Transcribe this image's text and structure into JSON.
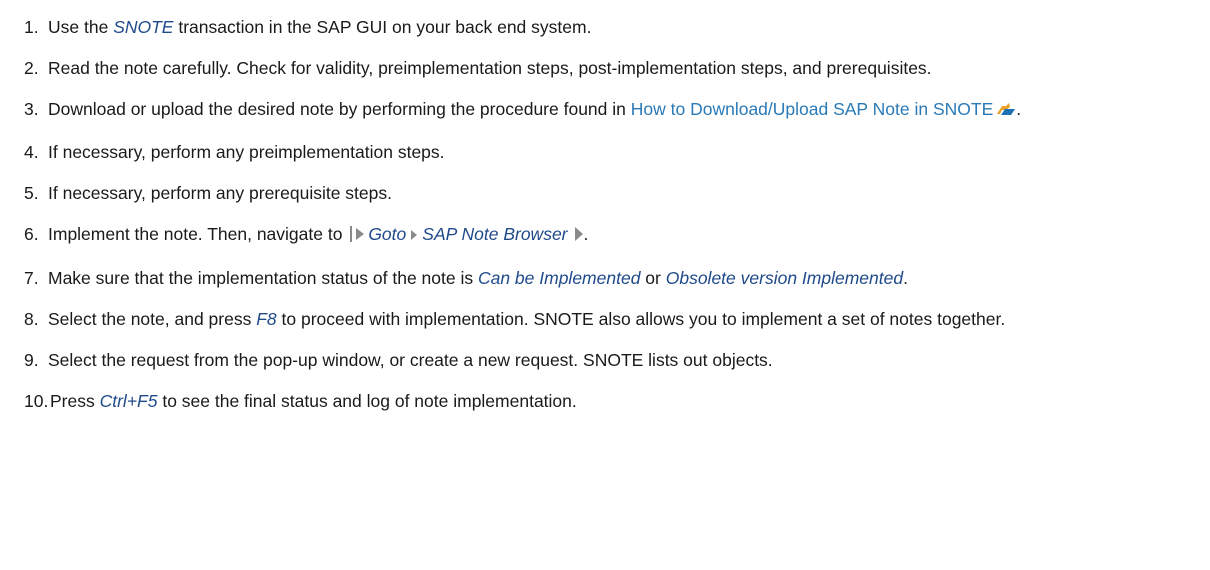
{
  "steps": [
    {
      "num": "1.",
      "parts": [
        {
          "t": "Use the "
        },
        {
          "t": "SNOTE",
          "k": "ui"
        },
        {
          "t": " transaction in the SAP GUI on your back end system."
        }
      ]
    },
    {
      "num": "2.",
      "parts": [
        {
          "t": "Read the note carefully. Check for validity, preimplementation steps, post-implementation steps, and prerequisites."
        }
      ]
    },
    {
      "num": "3.",
      "parts": [
        {
          "t": "Download or upload the desired note by performing the procedure found in "
        },
        {
          "t": "How to Download/Upload SAP Note in SNOTE",
          "k": "link"
        },
        {
          "k": "ext-icon"
        },
        {
          "t": "."
        }
      ]
    },
    {
      "num": "4.",
      "parts": [
        {
          "t": "If necessary, perform any preimplementation steps."
        }
      ]
    },
    {
      "num": "5.",
      "parts": [
        {
          "t": "If necessary, perform any prerequisite steps."
        }
      ]
    },
    {
      "num": "6.",
      "parts": [
        {
          "t": "Implement the note. Then, navigate to "
        },
        {
          "k": "menu-start"
        },
        {
          "t": "Goto",
          "k": "ui"
        },
        {
          "k": "menu-sep"
        },
        {
          "t": "SAP Note Browser",
          "k": "ui"
        },
        {
          "k": "menu-end"
        },
        {
          "t": "."
        }
      ]
    },
    {
      "num": "7.",
      "parts": [
        {
          "t": "Make sure that the implementation status of the note is "
        },
        {
          "t": "Can be Implemented",
          "k": "ui"
        },
        {
          "t": " or "
        },
        {
          "t": "Obsolete version Implemented",
          "k": "ui"
        },
        {
          "t": "."
        }
      ]
    },
    {
      "num": "8.",
      "parts": [
        {
          "t": "Select the note, and press "
        },
        {
          "t": "F8",
          "k": "ui"
        },
        {
          "t": " to proceed with implementation. SNOTE also allows you to implement a set of notes together."
        }
      ]
    },
    {
      "num": "9.",
      "parts": [
        {
          "t": "Select the request from the pop-up window, or create a new request. SNOTE lists out objects."
        }
      ]
    },
    {
      "num": "10.",
      "parts": [
        {
          "t": "Press "
        },
        {
          "t": "Ctrl+F5",
          "k": "ui"
        },
        {
          "t": " to see the final status and log of note implementation."
        }
      ]
    }
  ],
  "icons": {
    "ext-icon": "external-document-icon",
    "menu-start": "menu-path-start-icon",
    "menu-sep": "menu-path-separator-icon",
    "menu-end": "menu-path-end-icon"
  },
  "colors": {
    "text": "#1a1a1a",
    "ui_term": "#1f4a8a",
    "link": "#2a7ab8",
    "icon_orange": "#e8a12b",
    "icon_blue": "#1f6fb5",
    "menu_arrow": "#8a8a8a"
  }
}
